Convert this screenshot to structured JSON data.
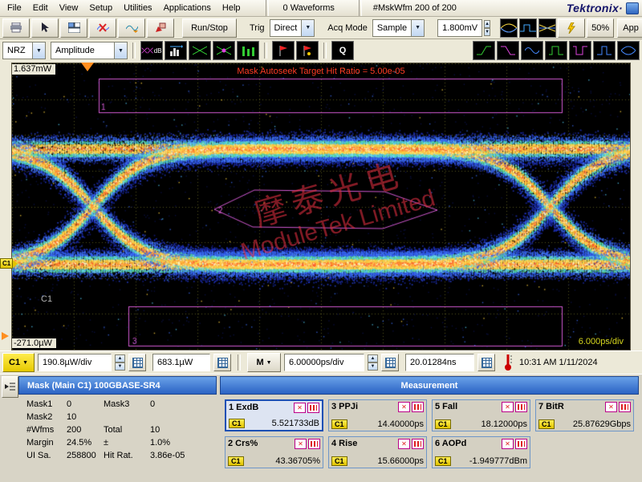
{
  "accent_colors": {
    "header_blue": "#2a62c4",
    "badge_yellow": "#ffee52",
    "mask_magenta": "#d058d0",
    "alert_red": "#ff3c24",
    "trace_blue": "#2236cc",
    "trace_hot": "#ffd23c"
  },
  "menubar": {
    "items": [
      "File",
      "Edit",
      "View",
      "Setup",
      "Utilities",
      "Applications",
      "Help"
    ],
    "waveform_count": "0 Waveforms",
    "mask_wfm_count": "#MskWfm  200 of 200",
    "logo": "Tektronix·"
  },
  "toolbar_main": {
    "icons": [
      "print-icon",
      "pointer-icon",
      "tile-windows-icon",
      "clear-data-icon",
      "waveform-refresh-icon",
      "annotate-icon",
      "eye-diagram-icon",
      "pulse-wfm-icon",
      "overlay-wfm-icon",
      "autoset-lightning-icon"
    ],
    "run_stop_label": "Run/Stop",
    "trig_label": "Trig",
    "trig_value": "Direct",
    "acq_mode_label": "Acq Mode",
    "acq_mode_value": "Sample",
    "trigger_level": "1.800mV",
    "fifty_pct_label": "50%",
    "app_label": "App"
  },
  "toolbar_measure": {
    "signal_type": "NRZ",
    "category": "Amplitude",
    "q_label": "Q",
    "icons": [
      "extinction-db-icon",
      "histogram-icon",
      "mask-test-icon",
      "mask-margin-icon",
      "vertical-bars-icon",
      "flag-red-icon",
      "flag-red2-icon",
      "q-factor-button",
      "rise-green-icon",
      "rise-magenta-icon",
      "sine-blue-icon",
      "pulse-green-icon",
      "pulse-magenta-icon",
      "pulse-blue-icon",
      "eye-blue-icon"
    ]
  },
  "display": {
    "top_scale": "1.637mW",
    "bottom_scale": "-271.0µW",
    "time_scale": "6.000ps/div",
    "autoseek_text": "Mask Autoseek Target Hit Ratio = 5.00e-05",
    "channel_label": "C1",
    "channel_badge": "C1",
    "mask_labels": [
      "1",
      "2",
      "3"
    ]
  },
  "statusbar": {
    "channel": "C1",
    "vertical_scale": "190.8µW/div",
    "vertical_offset": "683.1µW",
    "timebase": "M",
    "horizontal_scale": "6.00000ps/div",
    "horizontal_position": "20.01284ns",
    "datetime": "10:31 AM 1/11/2024"
  },
  "mask_panel": {
    "title": "Mask (Main  C1) 100GBASE-SR4",
    "stats": [
      {
        "label": "Mask1",
        "value": "0",
        "label2": "Mask3",
        "value2": "0"
      },
      {
        "label": "Mask2",
        "value": "10",
        "label2": "",
        "value2": ""
      },
      {
        "label": "#Wfms",
        "value": "200",
        "label2": "Total",
        "value2": "10"
      },
      {
        "label": "Margin",
        "value": "24.5%",
        "label2": "±",
        "value2": "1.0%"
      },
      {
        "label": "UI Sa.",
        "value": "258800",
        "label2": "Hit Rat.",
        "value2": "3.86e-05"
      }
    ]
  },
  "measurement_panel": {
    "title": "Measurement",
    "cells": [
      {
        "label": "1 ExdB",
        "value": "5.521733dB",
        "source": "C1"
      },
      {
        "label": "3 PPJi",
        "value": "14.40000ps",
        "source": "C1"
      },
      {
        "label": "5 Fall",
        "value": "18.12000ps",
        "source": "C1"
      },
      {
        "label": "7 BitR",
        "value": "25.87629Gbps",
        "source": "C1"
      },
      {
        "label": "2 Crs%",
        "value": "43.36705%",
        "source": "C1"
      },
      {
        "label": "4 Rise",
        "value": "15.66000ps",
        "source": "C1"
      },
      {
        "label": "6 AOPd",
        "value": "-1.949777dBm",
        "source": "C1"
      }
    ]
  },
  "watermark": {
    "line1": "摩泰光电",
    "line2": "ModuleTek Limited"
  }
}
